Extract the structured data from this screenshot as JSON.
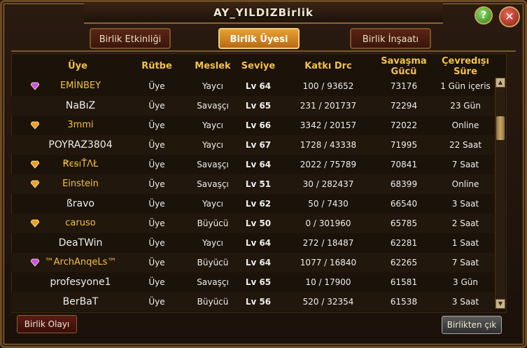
{
  "window": {
    "title": "AY_YILDIZBirlik"
  },
  "icons": {
    "help": "?",
    "close": "✕",
    "scroll_up": "▲",
    "scroll_down": "▼"
  },
  "tabs": [
    {
      "label": "Birlik Etkinliği",
      "active": false
    },
    {
      "label": "Birlik Üyesi",
      "active": true
    },
    {
      "label": "Birlik İnşaatı",
      "active": false
    }
  ],
  "table": {
    "headers": [
      "Üye",
      "Rütbe",
      "Meslek",
      "Seviye",
      "Katkı Drc",
      "Savaşma Gücü",
      "Çevredışı Süre"
    ],
    "rows": [
      {
        "icon": "purple-gem-icon",
        "name": "EMİNBEY",
        "rank": "Üye",
        "job": "Yaycı",
        "level": "Lv 64",
        "contrib": "100 / 93652",
        "power": "73176",
        "offline": "1 Gün içeris"
      },
      {
        "icon": "",
        "name": "NaBıZ",
        "rank": "Üye",
        "job": "Savaşçı",
        "level": "Lv 65",
        "contrib": "231 / 201737",
        "power": "72294",
        "offline": "23 Gün"
      },
      {
        "icon": "gold-gem-icon",
        "name": "3mmi",
        "rank": "Üye",
        "job": "Yaycı",
        "level": "Lv 66",
        "contrib": "3342 / 20157",
        "power": "72022",
        "offline": "Online"
      },
      {
        "icon": "",
        "name": "POYRAZ3804",
        "rank": "Üye",
        "job": "Yaycı",
        "level": "Lv 67",
        "contrib": "1728 / 43338",
        "power": "71995",
        "offline": "22 Saat"
      },
      {
        "icon": "gold-gem-icon",
        "name": "ꞦєꞩıŤΛŁ",
        "rank": "Üye",
        "job": "Savaşçı",
        "level": "Lv 64",
        "contrib": "2022 / 75789",
        "power": "70841",
        "offline": "7 Saat"
      },
      {
        "icon": "gold-gem-icon",
        "name": "Einstein",
        "rank": "Üye",
        "job": "Savaşçı",
        "level": "Lv 51",
        "contrib": "30 / 282437",
        "power": "68399",
        "offline": "Online"
      },
      {
        "icon": "",
        "name": "ßravo",
        "rank": "Üye",
        "job": "Yaycı",
        "level": "Lv 62",
        "contrib": "50 / 7430",
        "power": "66540",
        "offline": "3 Saat"
      },
      {
        "icon": "gold-gem-icon",
        "name": "caruso",
        "rank": "Üye",
        "job": "Büyücü",
        "level": "Lv 50",
        "contrib": "0 / 301960",
        "power": "65785",
        "offline": "2 Saat"
      },
      {
        "icon": "",
        "name": "DeaTWin",
        "rank": "Üye",
        "job": "Yaycı",
        "level": "Lv 64",
        "contrib": "272 / 18487",
        "power": "62281",
        "offline": "1 Saat"
      },
      {
        "icon": "purple-gem-icon",
        "name": "™ArchAnqeLs™",
        "rank": "Üye",
        "job": "Büyücü",
        "level": "Lv 64",
        "contrib": "1077 / 16840",
        "power": "62265",
        "offline": "7 Saat"
      },
      {
        "icon": "",
        "name": "profesyone1",
        "rank": "Üye",
        "job": "Savaşçı",
        "level": "Lv 65",
        "contrib": "10 / 17900",
        "power": "61581",
        "offline": "3 Gün"
      },
      {
        "icon": "",
        "name": "BerBaT",
        "rank": "Üye",
        "job": "Büyücü",
        "level": "Lv 56",
        "contrib": "520 / 32354",
        "power": "61538",
        "offline": "3 Saat"
      }
    ]
  },
  "footer": {
    "left_button": "Birlik Olayı",
    "right_button": "Birlikten çık"
  },
  "colors": {
    "header": "#f2c14a",
    "gold_name": "#f0c040",
    "accent": "#e8a030"
  }
}
